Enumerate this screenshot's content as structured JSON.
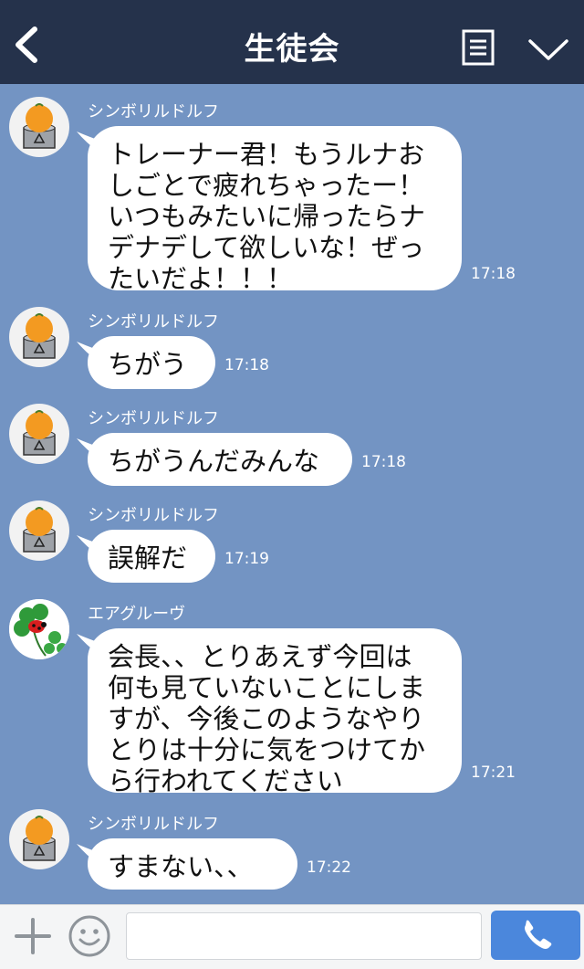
{
  "header": {
    "title": "生徒会"
  },
  "messages": [
    {
      "sender": "シンボリルドルフ",
      "text": "トレーナー君！もうルナお\nしごとで疲れちゃったー！\nいつもみたいに帰ったらナ\nデナデして欲しいな！ぜっ\nたいだよ！！！",
      "time": "17:18",
      "avatar": "mikan-can-avatar"
    },
    {
      "sender": "シンボリルドルフ",
      "text": "ちがう",
      "time": "17:18",
      "avatar": "mikan-can-avatar"
    },
    {
      "sender": "シンボリルドルフ",
      "text": "ちがうんだみんな",
      "time": "17:18",
      "avatar": "mikan-can-avatar"
    },
    {
      "sender": "シンボリルドルフ",
      "text": "誤解だ",
      "time": "17:19",
      "avatar": "mikan-can-avatar"
    },
    {
      "sender": "エアグルーヴ",
      "text": "会長、、とりあえず今回は\n何も見ていないことにしま\nすが、今後このようなやり\nとりは十分に気をつけてか\nら行われてください",
      "time": "17:21",
      "avatar": "clover-ladybug-avatar"
    },
    {
      "sender": "シンボリルドルフ",
      "text": "すまない、、",
      "time": "17:22",
      "avatar": "mikan-can-avatar"
    }
  ],
  "icons": {
    "back": "chevron-left-icon",
    "menu": "notes-icon",
    "collapse": "chevron-down-icon",
    "add": "plus-icon",
    "sticker": "smile-icon",
    "send": "phone-icon"
  },
  "colors": {
    "header_bg": "#25324b",
    "chat_bg": "#7394c3",
    "bubble": "#ffffff",
    "send_button": "#4b87dc"
  },
  "composer": {
    "placeholder": ""
  }
}
